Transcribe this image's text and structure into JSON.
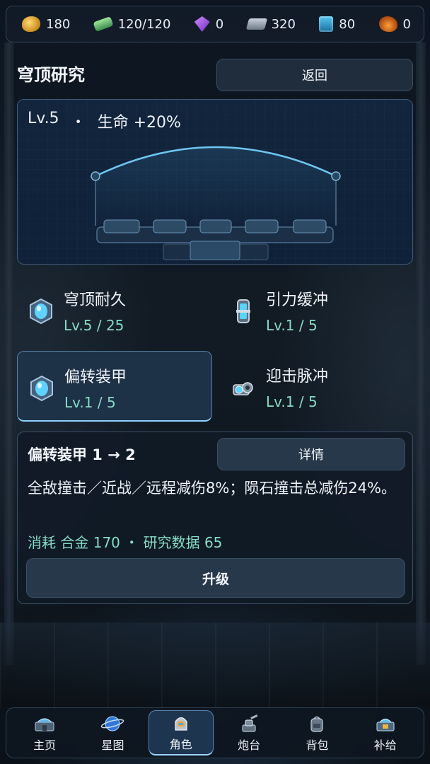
{
  "resources": [
    {
      "icon": "gold-coin-icon",
      "value": "180"
    },
    {
      "icon": "energy-cell-icon",
      "value": "120/120"
    },
    {
      "icon": "purple-gem-icon",
      "value": "0"
    },
    {
      "icon": "metal-ingot-icon",
      "value": "320"
    },
    {
      "icon": "data-chip-icon",
      "value": "80"
    },
    {
      "icon": "ore-icon",
      "value": "0"
    }
  ],
  "header": {
    "title": "穹顶研究",
    "back_label": "返回"
  },
  "dome": {
    "level": "Lv.5",
    "separator": "・",
    "bonus": "生命 +20%"
  },
  "research": [
    {
      "name": "穹顶耐久",
      "level": "Lv.5 / 25",
      "icon": "dome-shield-icon"
    },
    {
      "name": "引力缓冲",
      "level": "Lv.1 / 5",
      "icon": "gravity-capsule-icon"
    },
    {
      "name": "偏转装甲",
      "level": "Lv.1 / 5",
      "icon": "deflector-armor-icon",
      "selected": true
    },
    {
      "name": "迎击脉冲",
      "level": "Lv.1 / 5",
      "icon": "pulse-cannon-icon"
    }
  ],
  "detail": {
    "title": "偏转装甲  1 → 2",
    "details_label": "详情",
    "description": "全敌撞击／近战／远程减伤8%；陨石撞击总减伤24%。",
    "cost": "消耗 合金 170 ・ 研究数据 65",
    "upgrade_label": "升级"
  },
  "nav": [
    {
      "label": "主页",
      "icon": "home-base-icon"
    },
    {
      "label": "星图",
      "icon": "planet-icon"
    },
    {
      "label": "角色",
      "icon": "character-helmet-icon",
      "active": true
    },
    {
      "label": "炮台",
      "icon": "turret-icon"
    },
    {
      "label": "背包",
      "icon": "backpack-icon"
    },
    {
      "label": "补给",
      "icon": "supply-icon"
    }
  ],
  "colors": {
    "accent": "#86dbc4",
    "highlight": "#8fd0ff",
    "panel": "#12253d"
  }
}
